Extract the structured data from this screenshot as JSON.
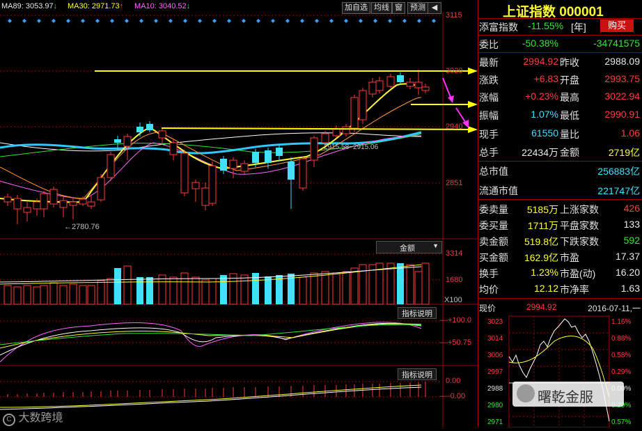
{
  "ma": {
    "ma89_label": "MA89: 3053.97",
    "ma30_label": "MA30: 2971.73",
    "ma10_label": "MA10: 3040.52",
    "ma89_color": "#e8e8e8",
    "ma30_color": "#ffff33",
    "ma10_color": "#ff66ff"
  },
  "toolbar": {
    "add_watchlist": "加自选",
    "ma_lines": "均线",
    "window": "窗",
    "forecast": "预测"
  },
  "price_axis": [
    "3115",
    "3020",
    "2940",
    "2851"
  ],
  "low_marker": "2780.76",
  "mid_annotation": "2915.58~2915.06",
  "volume_panel": {
    "selector": "金额",
    "ticks": [
      "3314",
      "1680"
    ],
    "unit": "X100"
  },
  "indicator1": {
    "button": "指标说明",
    "ticks": [
      "+100.0",
      "+50.75"
    ]
  },
  "indicator2": {
    "button": "指标说明",
    "ticks": [
      "0.00",
      "-0.00"
    ]
  },
  "watermark": "大数跨境",
  "index_header": {
    "title": "上证指数 000001"
  },
  "fortune": {
    "label": "添富指数",
    "value": "-11.55%",
    "period": "[年]",
    "buy_button": "购买"
  },
  "quote": {
    "weibi_label": "委比",
    "weibi_value": "-50.38%",
    "weicha_value": "-34741575",
    "latest_label": "最新",
    "latest_value": "2994.92",
    "prev_close_label": "昨收",
    "prev_close_value": "2988.09",
    "change_label": "涨跌",
    "change_value": "+6.83",
    "open_label": "开盘",
    "open_value": "2993.75",
    "pct_label": "涨幅",
    "pct_value": "+0.23%",
    "high_label": "最高",
    "high_value": "3022.94",
    "amp_label": "振幅",
    "amp_value": "1.07%",
    "low_label": "最低",
    "low_value": "2990.91",
    "cur_vol_label": "现手",
    "cur_vol_value": "61550",
    "vol_ratio_label": "量比",
    "vol_ratio_value": "1.06",
    "total_vol_label": "总手",
    "total_vol_value": "22434万",
    "amount_label": "金额",
    "amount_value": "2719亿",
    "mktcap_label": "总市值",
    "mktcap_value": "256883亿",
    "float_cap_label": "流通市值",
    "float_cap_value": "221747亿",
    "ask_vol_label": "委卖量",
    "ask_vol_value": "5185万",
    "up_count_label": "上涨家数",
    "up_count_value": "426",
    "bid_vol_label": "委买量",
    "bid_vol_value": "1711万",
    "flat_count_label": "平盘家数",
    "flat_count_value": "133",
    "sell_amt_label": "卖金额",
    "sell_amt_value": "519.8亿",
    "down_count_label": "下跌家数",
    "down_count_value": "592",
    "buy_amt_label": "买金额",
    "buy_amt_value": "162.9亿",
    "pe_label": "市盈",
    "pe_value": "17.37",
    "turnover_label": "换手",
    "turnover_value": "1.23%",
    "pe_dyn_label": "市盈(动)",
    "pe_dyn_value": "16.20",
    "avg_label": "均价",
    "avg_value": "12.12",
    "pb_label": "市净率",
    "pb_value": "1.63"
  },
  "intraday": {
    "price_label": "现价",
    "price_value": "2994.92",
    "date": "2016-07-11,一",
    "left_ticks": [
      "3023",
      "3014",
      "3006",
      "2997",
      "2988",
      "2980",
      "2971"
    ],
    "right_ticks": [
      "1.16%",
      "0.88%",
      "0.58%",
      "0.29%",
      "0.00%",
      "0.29%",
      "0.57%"
    ]
  },
  "wechat_watermark": "曙乾金服",
  "colors": {
    "up": "#ff3d3d",
    "down": "#40e0ff",
    "grid": "#a00000",
    "annotation_arrow": "#ffff00",
    "accent_arrow": "#ff33ff"
  }
}
